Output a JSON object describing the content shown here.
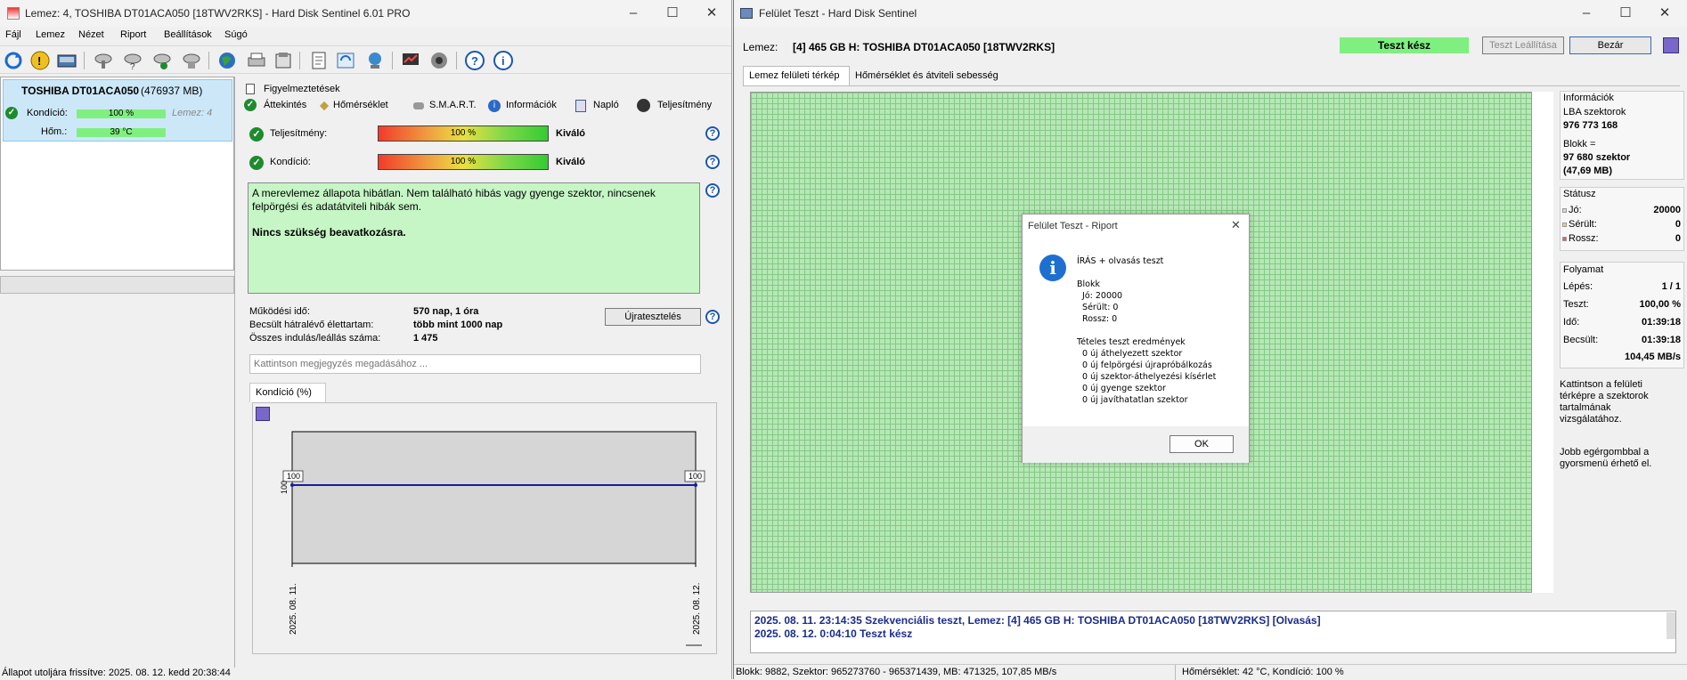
{
  "left_window": {
    "title": "Lemez: 4, TOSHIBA DT01ACA050 [18TWV2RKS]  -  Hard Disk Sentinel 6.01 PRO",
    "menu": [
      "Fájl",
      "Lemez",
      "Nézet",
      "Riport",
      "Beállítások",
      "Súgó"
    ],
    "disk": {
      "name": "TOSHIBA DT01ACA050",
      "size": "(476937 MB)",
      "condition_label": "Kondíció:",
      "condition_value": "100 %",
      "disk_no": "Lemez: 4",
      "temp_label": "Hőm.:",
      "temp_value": "39 °C"
    },
    "tabs": {
      "warnings": "Figyelmeztetések",
      "overview": "Áttekintés",
      "temperature": "Hőmérséklet",
      "smart": "S.M.A.R.T.",
      "info": "Információk",
      "log": "Napló",
      "performance": "Teljesítmény"
    },
    "performance": {
      "label": "Teljesítmény:",
      "value": "100 %",
      "rating": "Kiváló"
    },
    "condition": {
      "label": "Kondíció:",
      "value": "100 %",
      "rating": "Kiváló"
    },
    "status_text_1": "A merevlemez állapota hibátlan. Nem található hibás vagy gyenge szektor, nincsenek felpörgési és adatátviteli hibák sem.",
    "status_text_2": "Nincs szükség beavatkozásra.",
    "stats": {
      "uptime_label": "Működési idő:",
      "uptime_value": "570 nap, 1 óra",
      "remaining_label": "Becsült hátralévő élettartam:",
      "remaining_value": "több mint 1000 nap",
      "starts_label": "Összes indulás/leállás száma:",
      "starts_value": "1 475"
    },
    "retest_button": "Újratesztelés",
    "comment_placeholder": "Kattintson megjegyzés megadásához ...",
    "chart_tab": "Kondíció  (%)",
    "statusbar": "Állapot utoljára frissítve: 2025. 08. 12. kedd 20:38:44"
  },
  "chart_data": {
    "type": "line",
    "title": "",
    "x": [
      "2025. 08. 11.",
      "2025. 08. 12."
    ],
    "series": [
      {
        "values": [
          100,
          100
        ]
      }
    ],
    "point_labels": [
      "100",
      "100"
    ],
    "ylabel": "100",
    "ylim": [
      0,
      100
    ],
    "color": "#1a1aa0"
  },
  "right_window": {
    "title": "Felület Teszt - Hard Disk Sentinel",
    "disk_label": "Lemez:",
    "disk_value": "[4] 465 GB H: TOSHIBA DT01ACA050 [18TWV2RKS]",
    "status_badge": "Teszt kész",
    "stop_button": "Teszt Leállítása",
    "close_button": "Bezár",
    "tab_map": "Lemez felületi térkép",
    "tab_temp": "Hőmérséklet és átviteli sebesség",
    "info": {
      "header": "Információk",
      "lba_label": "LBA szektorok",
      "lba_value": "976 773 168",
      "block_label": "Blokk =",
      "block_value_1": "97 680 szektor",
      "block_value_2": "(47,69 MB)"
    },
    "status": {
      "header": "Státusz",
      "good_label": "Jó:",
      "good_value": "20000",
      "damaged_label": "Sérült:",
      "damaged_value": "0",
      "bad_label": "Rossz:",
      "bad_value": "0"
    },
    "progress": {
      "header": "Folyamat",
      "step_label": "Lépés:",
      "step_value": "1 / 1",
      "test_label": "Teszt:",
      "test_value": "100,00 %",
      "time_label": "Idő:",
      "time_value": "01:39:18",
      "est_label": "Becsült:",
      "est_value": "01:39:18",
      "speed": "104,45 MB/s"
    },
    "hint_1": "Kattintson a felületi térképre a szektorok tartalmának vizsgálatához.",
    "hint_2": "Jobb egérgombbal a gyorsmenü érhető el.",
    "log_1": "2025. 08. 11.  23:14:35   Szekvenciális teszt, Lemez: [4] 465 GB H: TOSHIBA DT01ACA050 [18TWV2RKS] [Olvasás]",
    "log_2": "2025. 08. 12.  0:04:10   Teszt kész",
    "statusbar_left": "Blokk: 9882, Szektor: 965273760 - 965371439, MB: 471325, 107,85 MB/s",
    "statusbar_right": "Hőmérséklet: 42  °C,  Kondíció: 100 %"
  },
  "dialog": {
    "title": "Felület Teszt - Riport",
    "body": "ÍRÁS + olvasás teszt\n\nBlokk\n  Jó: 20000\n  Sérült: 0\n  Rossz: 0\n\nTételes teszt eredmények\n  0 új áthelyezett szektor\n  0 új felpörgési újrapróbálkozás\n  0 új szektor-áthelyezési kísérlet\n  0 új gyenge szektor\n  0 új javíthatatlan szektor",
    "ok_button": "OK"
  },
  "colors": {
    "good_green": "#c6f6c6",
    "grid_green": "#b6e8b6",
    "status_badge": "#7ff07f",
    "link_blue": "#1a2c8c"
  }
}
